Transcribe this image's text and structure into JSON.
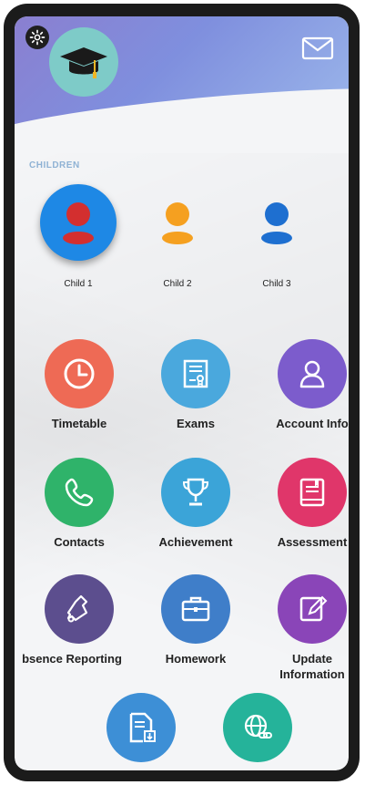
{
  "header": {
    "settings_icon": "gear-icon",
    "logo_icon": "graduation-cap-icon",
    "mail_icon": "envelope-icon"
  },
  "children": {
    "section_label": "CHILDREN",
    "items": [
      {
        "label": "Child 1",
        "color": "#d32f2f",
        "selected": true
      },
      {
        "label": "Child 2",
        "color": "#f5a020",
        "selected": false
      },
      {
        "label": "Child 3",
        "color": "#1e6fd0",
        "selected": false
      }
    ]
  },
  "menu": [
    {
      "label": "Timetable",
      "icon": "clock-icon",
      "color": "#ee6a55"
    },
    {
      "label": "Exams",
      "icon": "certificate-icon",
      "color": "#4aa8dd"
    },
    {
      "label": "Account Info",
      "icon": "user-icon",
      "color": "#7c5ccc"
    },
    {
      "label": "Contacts",
      "icon": "phone-icon",
      "color": "#2fb36a"
    },
    {
      "label": "Achievement",
      "icon": "trophy-icon",
      "color": "#3ba4d8"
    },
    {
      "label": "Assessment",
      "icon": "book-icon",
      "color": "#e0366a"
    },
    {
      "label": "bsence Reporting",
      "icon": "bell-icon",
      "color": "#5c4e8e"
    },
    {
      "label": "Homework",
      "icon": "briefcase-icon",
      "color": "#3f7ec9"
    },
    {
      "label": "Update Information",
      "icon": "edit-icon",
      "color": "#8a45b8"
    },
    {
      "label": "",
      "icon": "document-download-icon",
      "color": "#3d8fd6"
    },
    {
      "label": "",
      "icon": "globe-link-icon",
      "color": "#25b39a"
    }
  ]
}
